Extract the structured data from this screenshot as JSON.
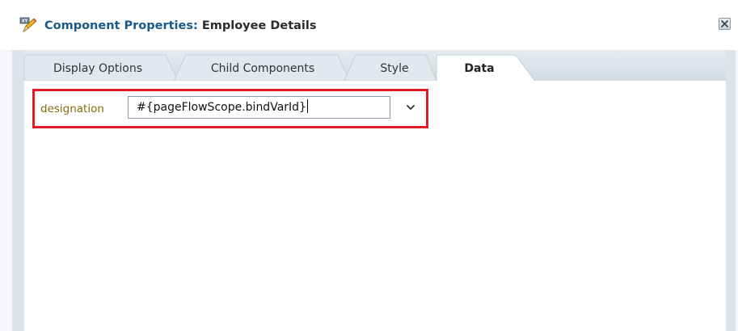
{
  "dialog": {
    "title_label": "Component Properties:",
    "title_value": " Employee Details"
  },
  "tabs": [
    {
      "label": "Display Options",
      "active": false
    },
    {
      "label": "Child Components",
      "active": false
    },
    {
      "label": "Style",
      "active": false
    },
    {
      "label": "Data",
      "active": true
    }
  ],
  "data_tab": {
    "field_label": "designation",
    "field_value": "#{pageFlowScope.bindVarId}"
  },
  "icons": {
    "title": "edit-properties-icon",
    "close": "close-icon",
    "dropdown": "chevron-down-icon"
  },
  "colors": {
    "highlight_border": "#e31b23",
    "label_text": "#8a6a10",
    "title_label": "#1a5a8a"
  }
}
